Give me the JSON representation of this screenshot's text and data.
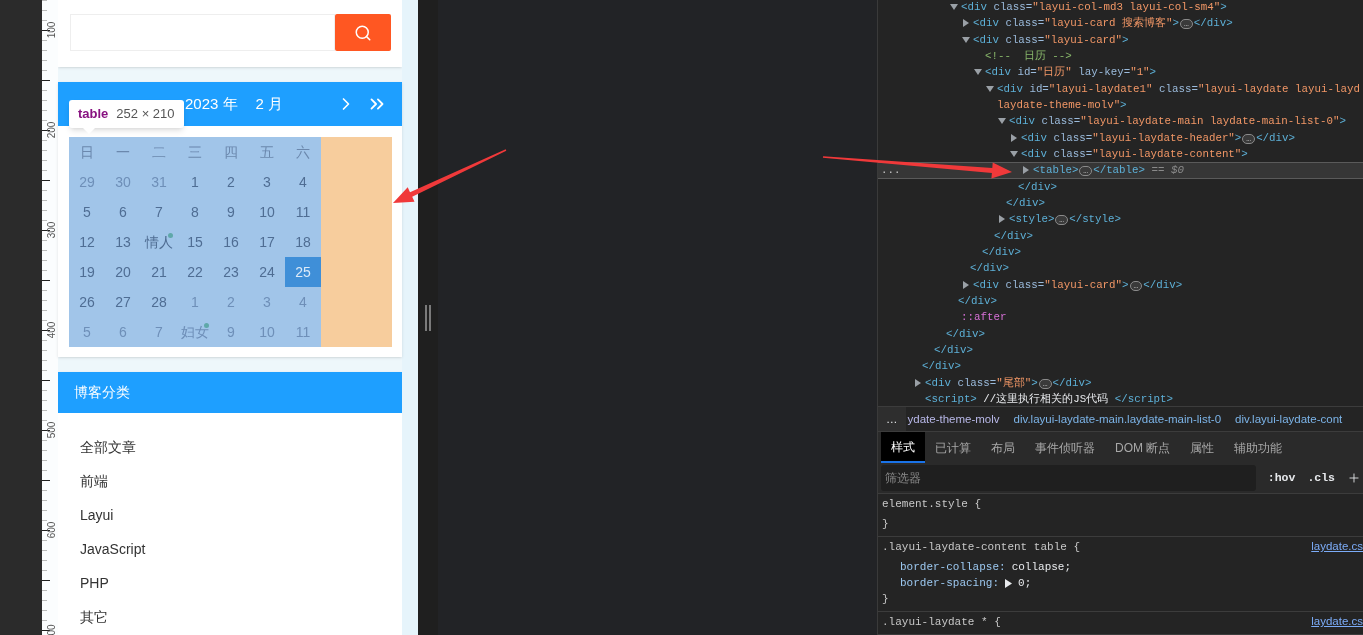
{
  "ruler": {
    "labels": [
      "100",
      "200",
      "300",
      "400",
      "500",
      "600",
      "00"
    ]
  },
  "calendar": {
    "year": "2023 年",
    "month": "2 月",
    "tooltip": {
      "tag": "table",
      "size": "252 × 210"
    },
    "weekdays": [
      "日",
      "一",
      "二",
      "三",
      "四",
      "五",
      "六"
    ],
    "weeks": [
      [
        {
          "label": "29",
          "muted": true,
          "selected": false,
          "mark": false
        },
        {
          "label": "30",
          "muted": true,
          "selected": false,
          "mark": false
        },
        {
          "label": "31",
          "muted": true,
          "selected": false,
          "mark": false
        },
        {
          "label": "1",
          "muted": false,
          "selected": false,
          "mark": false
        },
        {
          "label": "2",
          "muted": false,
          "selected": false,
          "mark": false
        },
        {
          "label": "3",
          "muted": false,
          "selected": false,
          "mark": false
        },
        {
          "label": "4",
          "muted": false,
          "selected": false,
          "mark": false
        }
      ],
      [
        {
          "label": "5",
          "muted": false,
          "selected": false,
          "mark": false
        },
        {
          "label": "6",
          "muted": false,
          "selected": false,
          "mark": false
        },
        {
          "label": "7",
          "muted": false,
          "selected": false,
          "mark": false
        },
        {
          "label": "8",
          "muted": false,
          "selected": false,
          "mark": false
        },
        {
          "label": "9",
          "muted": false,
          "selected": false,
          "mark": false
        },
        {
          "label": "10",
          "muted": false,
          "selected": false,
          "mark": false
        },
        {
          "label": "11",
          "muted": false,
          "selected": false,
          "mark": false
        }
      ],
      [
        {
          "label": "12",
          "muted": false,
          "selected": false,
          "mark": false
        },
        {
          "label": "13",
          "muted": false,
          "selected": false,
          "mark": false
        },
        {
          "label": "情人",
          "muted": false,
          "selected": false,
          "mark": true
        },
        {
          "label": "15",
          "muted": false,
          "selected": false,
          "mark": false
        },
        {
          "label": "16",
          "muted": false,
          "selected": false,
          "mark": false
        },
        {
          "label": "17",
          "muted": false,
          "selected": false,
          "mark": false
        },
        {
          "label": "18",
          "muted": false,
          "selected": false,
          "mark": false
        }
      ],
      [
        {
          "label": "19",
          "muted": false,
          "selected": false,
          "mark": false
        },
        {
          "label": "20",
          "muted": false,
          "selected": false,
          "mark": false
        },
        {
          "label": "21",
          "muted": false,
          "selected": false,
          "mark": false
        },
        {
          "label": "22",
          "muted": false,
          "selected": false,
          "mark": false
        },
        {
          "label": "23",
          "muted": false,
          "selected": false,
          "mark": false
        },
        {
          "label": "24",
          "muted": false,
          "selected": false,
          "mark": false
        },
        {
          "label": "25",
          "muted": false,
          "selected": true,
          "mark": false
        }
      ],
      [
        {
          "label": "26",
          "muted": false,
          "selected": false,
          "mark": false
        },
        {
          "label": "27",
          "muted": false,
          "selected": false,
          "mark": false
        },
        {
          "label": "28",
          "muted": false,
          "selected": false,
          "mark": false
        },
        {
          "label": "1",
          "muted": true,
          "selected": false,
          "mark": false
        },
        {
          "label": "2",
          "muted": true,
          "selected": false,
          "mark": false
        },
        {
          "label": "3",
          "muted": true,
          "selected": false,
          "mark": false
        },
        {
          "label": "4",
          "muted": true,
          "selected": false,
          "mark": false
        }
      ],
      [
        {
          "label": "5",
          "muted": true,
          "selected": false,
          "mark": false
        },
        {
          "label": "6",
          "muted": true,
          "selected": false,
          "mark": false
        },
        {
          "label": "7",
          "muted": true,
          "selected": false,
          "mark": false
        },
        {
          "label": "妇女",
          "muted": true,
          "selected": false,
          "mark": true
        },
        {
          "label": "9",
          "muted": true,
          "selected": false,
          "mark": false
        },
        {
          "label": "10",
          "muted": true,
          "selected": false,
          "mark": false
        },
        {
          "label": "11",
          "muted": true,
          "selected": false,
          "mark": false
        }
      ]
    ]
  },
  "category": {
    "title": "博客分类",
    "items": [
      "全部文章",
      "前端",
      "Layui",
      "JavaScript",
      "PHP",
      "其它"
    ]
  },
  "dom_tree": [
    {
      "children": [
        {
          "children": [
            {
              "children": [
                {
                  "children": [
                    {
                      "open": [
                        [
                          {
                            "text": "<div ",
                            "kind": "tag"
                          },
                          {
                            "text": "class=",
                            "kind": "attr"
                          },
                          {
                            "text": "\"layui-col-md3 layui-col-sm4\"",
                            "kind": "val"
                          },
                          {
                            "text": ">",
                            "kind": "tag"
                          }
                        ]
                      ],
                      "expanded": true,
                      "selected": false,
                      "children": [
                        {
                          "open": [
                            [
                              {
                                "text": "<div ",
                                "kind": "tag"
                              },
                              {
                                "text": "class=",
                                "kind": "attr"
                              },
                              {
                                "text": "\"layui-card 搜索博客\"",
                                "kind": "val"
                              },
                              {
                                "text": ">",
                                "kind": "tag"
                              },
                              {
                                "text": "…",
                                "kind": "ellipsis"
                              },
                              {
                                "text": "</div>",
                                "kind": "tag"
                              }
                            ]
                          ],
                          "expanded": false,
                          "selected": false
                        },
                        {
                          "open": [
                            [
                              {
                                "text": "<div ",
                                "kind": "tag"
                              },
                              {
                                "text": "class=",
                                "kind": "attr"
                              },
                              {
                                "text": "\"layui-card\"",
                                "kind": "val"
                              },
                              {
                                "text": ">",
                                "kind": "tag"
                              }
                            ]
                          ],
                          "expanded": true,
                          "selected": false,
                          "children": [
                            {
                              "open": [
                                [
                                  {
                                    "text": "<!--  日历 -->",
                                    "kind": "comment"
                                  }
                                ]
                              ],
                              "selected": false
                            },
                            {
                              "open": [
                                [
                                  {
                                    "text": "<div ",
                                    "kind": "tag"
                                  },
                                  {
                                    "text": "id=",
                                    "kind": "attr"
                                  },
                                  {
                                    "text": "\"日历\"",
                                    "kind": "val"
                                  },
                                  {
                                    "text": " lay-key=",
                                    "kind": "attr"
                                  },
                                  {
                                    "text": "\"1\"",
                                    "kind": "val"
                                  },
                                  {
                                    "text": ">",
                                    "kind": "tag"
                                  }
                                ]
                              ],
                              "expanded": true,
                              "selected": false,
                              "children": [
                                {
                                  "open": [
                                    [
                                      {
                                        "text": "<div ",
                                        "kind": "tag"
                                      },
                                      {
                                        "text": "id=",
                                        "kind": "attr"
                                      },
                                      {
                                        "text": "\"layui-laydate1\"",
                                        "kind": "val"
                                      },
                                      {
                                        "text": " class=",
                                        "kind": "attr"
                                      },
                                      {
                                        "text": "\"layui-laydate layui-layd",
                                        "kind": "val"
                                      }
                                    ],
                                    [
                                      {
                                        "text": "laydate-theme-molv\"",
                                        "kind": "val"
                                      },
                                      {
                                        "text": ">",
                                        "kind": "tag"
                                      }
                                    ]
                                  ],
                                  "expanded": true,
                                  "selected": false,
                                  "children": [
                                    {
                                      "open": [
                                        [
                                          {
                                            "text": "<div ",
                                            "kind": "tag"
                                          },
                                          {
                                            "text": "class=",
                                            "kind": "attr"
                                          },
                                          {
                                            "text": "\"layui-laydate-main laydate-main-list-0\"",
                                            "kind": "val"
                                          },
                                          {
                                            "text": ">",
                                            "kind": "tag"
                                          }
                                        ]
                                      ],
                                      "expanded": true,
                                      "selected": false,
                                      "children": [
                                        {
                                          "open": [
                                            [
                                              {
                                                "text": "<div ",
                                                "kind": "tag"
                                              },
                                              {
                                                "text": "class=",
                                                "kind": "attr"
                                              },
                                              {
                                                "text": "\"layui-laydate-header\"",
                                                "kind": "val"
                                              },
                                              {
                                                "text": ">",
                                                "kind": "tag"
                                              },
                                              {
                                                "text": "…",
                                                "kind": "ellipsis"
                                              },
                                              {
                                                "text": "</div>",
                                                "kind": "tag"
                                              }
                                            ]
                                          ],
                                          "expanded": false,
                                          "selected": false
                                        },
                                        {
                                          "open": [
                                            [
                                              {
                                                "text": "<div ",
                                                "kind": "tag"
                                              },
                                              {
                                                "text": "class=",
                                                "kind": "attr"
                                              },
                                              {
                                                "text": "\"layui-laydate-content\"",
                                                "kind": "val"
                                              },
                                              {
                                                "text": ">",
                                                "kind": "tag"
                                              }
                                            ]
                                          ],
                                          "expanded": true,
                                          "selected": false,
                                          "children": [
                                            {
                                              "open": [
                                                [
                                                  {
                                                    "text": "<table>",
                                                    "kind": "tag"
                                                  },
                                                  {
                                                    "text": "…",
                                                    "kind": "ellipsis"
                                                  },
                                                  {
                                                    "text": "</table>",
                                                    "kind": "tag"
                                                  },
                                                  {
                                                    "text": " == $0",
                                                    "kind": "ref"
                                                  }
                                                ]
                                              ],
                                              "expanded": false,
                                              "selected": true,
                                              "menu": "..."
                                            }
                                          ],
                                          "close": [
                                            {
                                              "text": "</div>",
                                              "kind": "tag"
                                            }
                                          ]
                                        }
                                      ],
                                      "close": [
                                        {
                                          "text": "</div>",
                                          "kind": "tag"
                                        }
                                      ]
                                    },
                                    {
                                      "open": [
                                        [
                                          {
                                            "text": "<style>",
                                            "kind": "tag"
                                          },
                                          {
                                            "text": "…",
                                            "kind": "ellipsis"
                                          },
                                          {
                                            "text": "</style>",
                                            "kind": "tag"
                                          }
                                        ]
                                      ],
                                      "expanded": false,
                                      "selected": false
                                    }
                                  ],
                                  "close": [
                                    {
                                      "text": "</div>",
                                      "kind": "tag"
                                    }
                                  ]
                                }
                              ],
                              "close": [
                                {
                                  "text": "</div>",
                                  "kind": "tag"
                                }
                              ]
                            }
                          ],
                          "close": [
                            {
                              "text": "</div>",
                              "kind": "tag"
                            }
                          ]
                        },
                        {
                          "open": [
                            [
                              {
                                "text": "<div ",
                                "kind": "tag"
                              },
                              {
                                "text": "class=",
                                "kind": "attr"
                              },
                              {
                                "text": "\"layui-card\"",
                                "kind": "val"
                              },
                              {
                                "text": ">",
                                "kind": "tag"
                              },
                              {
                                "text": "…",
                                "kind": "ellipsis"
                              },
                              {
                                "text": "</div>",
                                "kind": "tag"
                              }
                            ]
                          ],
                          "expanded": false,
                          "selected": false
                        }
                      ],
                      "close": [
                        {
                          "text": "</div>",
                          "kind": "tag"
                        }
                      ]
                    },
                    {
                      "open": [
                        [
                          {
                            "text": "::after",
                            "kind": "pseudo"
                          }
                        ]
                      ],
                      "selected": false
                    }
                  ],
                  "close": [
                    {
                      "text": "</div>",
                      "kind": "tag"
                    }
                  ]
                }
              ],
              "close": [
                {
                  "text": "</div>",
                  "kind": "tag"
                }
              ]
            }
          ],
          "close": [
            {
              "text": "</div>",
              "kind": "tag"
            }
          ]
        },
        {
          "open": [
            [
              {
                "text": "<div ",
                "kind": "tag"
              },
              {
                "text": "class=",
                "kind": "attr"
              },
              {
                "text": "\"尾部\"",
                "kind": "val"
              },
              {
                "text": ">",
                "kind": "tag"
              },
              {
                "text": "…",
                "kind": "ellipsis"
              },
              {
                "text": "</div>",
                "kind": "tag"
              }
            ]
          ],
          "expanded": false,
          "selected": false
        },
        {
          "open": [
            [
              {
                "text": "<script>",
                "kind": "tag"
              },
              {
                "text": " //这里执行相关的JS代码 ",
                "kind": "text"
              },
              {
                "text": "</script>",
                "kind": "tag"
              }
            ]
          ],
          "selected": false
        }
      ]
    }
  ],
  "breadcrumbs": {
    "overflow": "…",
    "items": [
      "ydate-theme-molv",
      "div.layui-laydate-main.laydate-main-list-0",
      "div.layui-laydate-cont"
    ]
  },
  "styles": {
    "tabs": [
      {
        "label": "样式",
        "selected": true
      },
      {
        "label": "已计算",
        "selected": false
      },
      {
        "label": "布局",
        "selected": false
      },
      {
        "label": "事件侦听器",
        "selected": false
      },
      {
        "label": "DOM 断点",
        "selected": false
      },
      {
        "label": "属性",
        "selected": false
      },
      {
        "label": "辅助功能",
        "selected": false
      }
    ],
    "filter": {
      "placeholder": "筛选器"
    },
    "toggles": [
      ":hov",
      ".cls"
    ],
    "rules": [
      {
        "selector": "element.style",
        "open": "{",
        "close": "}"
      },
      {
        "selector": ".layui-laydate-content table",
        "open": "{",
        "source": "laydate.cs",
        "close": "}",
        "declarations": [
          {
            "property": "border-collapse:",
            "value": "collapse;",
            "kind": "plain"
          },
          {
            "property": "border-spacing:",
            "value": "0;",
            "kind": "expandable"
          }
        ]
      },
      {
        "selector": ".layui-laydate *",
        "open": "{",
        "source": "laydate.cs"
      }
    ]
  }
}
